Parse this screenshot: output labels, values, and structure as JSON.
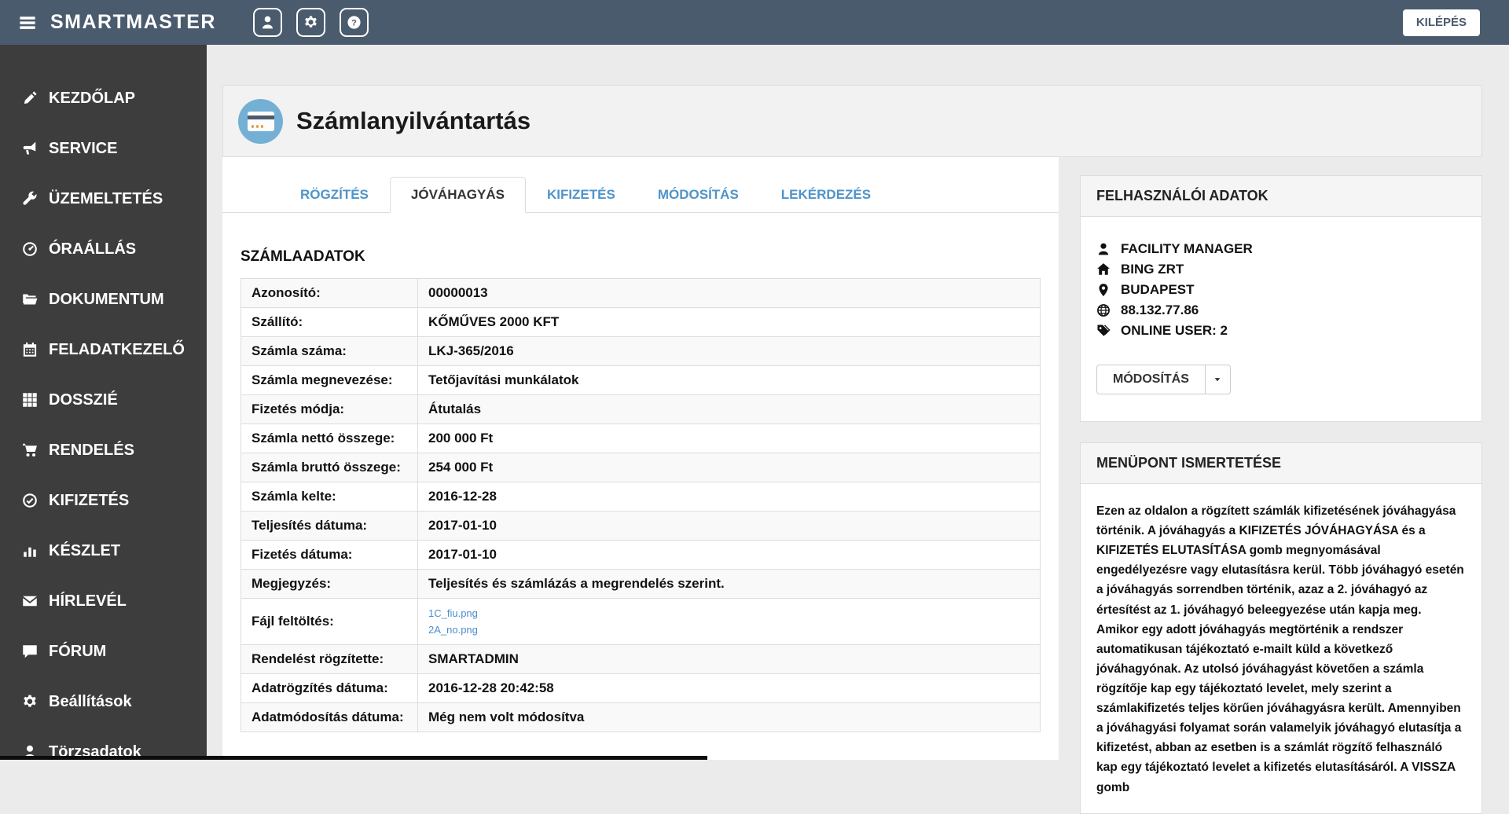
{
  "colors": {
    "topbar": "#4b5b6e",
    "sidebar": "#3d3d3d",
    "accent": "#4f94c9",
    "link": "#4b8fce",
    "icon_circle": "#74b0d4"
  },
  "header": {
    "app_title": "SMARTMASTER",
    "logout_label": "KILÉPÉS"
  },
  "sidebar": {
    "items": [
      {
        "name": "kezdolap",
        "icon": "edit",
        "label": "KEZDŐLAP"
      },
      {
        "name": "service",
        "icon": "megaphone",
        "label": "SERVICE"
      },
      {
        "name": "uzemeltetes",
        "icon": "wrench",
        "label": "ÜZEMELTETÉS"
      },
      {
        "name": "oraallas",
        "icon": "gauge",
        "label": "ÓRAÁLLÁS"
      },
      {
        "name": "dokumentum",
        "icon": "folder",
        "label": "DOKUMENTUM"
      },
      {
        "name": "feladatkezelo",
        "icon": "calendar",
        "label": "FELADATKEZELŐ"
      },
      {
        "name": "dosszie",
        "icon": "grid",
        "label": "DOSSZIÉ"
      },
      {
        "name": "rendeles",
        "icon": "cart",
        "label": "RENDELÉS"
      },
      {
        "name": "kifizetes",
        "icon": "check-circle",
        "label": "KIFIZETÉS"
      },
      {
        "name": "keszlet",
        "icon": "bar-chart",
        "label": "KÉSZLET"
      },
      {
        "name": "hirlevel",
        "icon": "envelope",
        "label": "HÍRLEVÉL"
      },
      {
        "name": "forum",
        "icon": "comment",
        "label": "FÓRUM"
      },
      {
        "name": "beallitasok",
        "icon": "gear",
        "label": "Beállítások"
      },
      {
        "name": "torzsadatok",
        "icon": "user",
        "label": "Törzsadatok"
      }
    ]
  },
  "page": {
    "title": "Számlanyilvántartás"
  },
  "tabs": [
    {
      "name": "rogzites",
      "label": "RÖGZÍTÉS",
      "active": false
    },
    {
      "name": "jovahagyas",
      "label": "JÓVÁHAGYÁS",
      "active": true
    },
    {
      "name": "kifizetes",
      "label": "KIFIZETÉS",
      "active": false
    },
    {
      "name": "modositas",
      "label": "MÓDOSÍTÁS",
      "active": false
    },
    {
      "name": "lekerdezes",
      "label": "LEKÉRDEZÉS",
      "active": false
    }
  ],
  "invoice": {
    "section_title": "SZÁMLAADATOK",
    "rows": [
      {
        "label": "Azonosító:",
        "value": "00000013"
      },
      {
        "label": "Szállító:",
        "value": "KŐMŰVES 2000 KFT"
      },
      {
        "label": "Számla száma:",
        "value": "LKJ-365/2016"
      },
      {
        "label": "Számla megnevezése:",
        "value": "Tetőjavítási munkálatok"
      },
      {
        "label": "Fizetés módja:",
        "value": "Átutalás"
      },
      {
        "label": "Számla nettó összege:",
        "value": "200 000 Ft"
      },
      {
        "label": "Számla bruttó összege:",
        "value": "254 000 Ft"
      },
      {
        "label": "Számla kelte:",
        "value": "2016-12-28"
      },
      {
        "label": "Teljesítés dátuma:",
        "value": "2017-01-10"
      },
      {
        "label": "Fizetés dátuma:",
        "value": "2017-01-10"
      },
      {
        "label": "Megjegyzés:",
        "value": "Teljesítés és számlázás a megrendelés szerint."
      },
      {
        "label": "Fájl feltöltés:",
        "links": [
          "1C_fiu.png",
          "2A_no.png"
        ]
      },
      {
        "label": "Rendelést rögzítette:",
        "value": "SMARTADMIN"
      },
      {
        "label": "Adatrögzítés dátuma:",
        "value": "2016-12-28 20:42:58"
      },
      {
        "label": "Adatmódosítás dátuma:",
        "value": "Még nem volt módosítva"
      }
    ]
  },
  "user_panel": {
    "title": "FELHASZNÁLÓI ADATOK",
    "entries": [
      {
        "icon": "user",
        "text": "FACILITY MANAGER"
      },
      {
        "icon": "home",
        "text": "BING ZRT"
      },
      {
        "icon": "map-marker",
        "text": "BUDAPEST"
      },
      {
        "icon": "globe",
        "text": "88.132.77.86"
      },
      {
        "icon": "tags",
        "text": "ONLINE USER: 2"
      }
    ],
    "modify_label": "MÓDOSÍTÁS"
  },
  "info_panel": {
    "title": "MENÜPONT ISMERTETÉSE",
    "text": "Ezen az oldalon a rögzített számlák kifizetésének jóváhagyása történik. A jóváhagyás a KIFIZETÉS JÓVÁHAGYÁSA és a KIFIZETÉS ELUTASÍTÁSA gomb megnyomásával engedélyezésre vagy elutasításra kerül. Több jóváhagyó esetén a jóváhagyás sorrendben történik, azaz a 2. jóváhagyó az értesítést az 1. jóváhagyó beleegyezése után kapja meg. Amikor egy adott jóváhagyás megtörténik a rendszer automatikusan tájékoztató e-mailt küld a következő jóváhagyónak. Az utolsó jóváhagyást követően a számla rögzítője kap egy tájékoztató levelet, mely szerint a számlakifizetés teljes körűen jóváhagyásra került. Amennyiben a jóváhagyási folyamat során valamelyik jóváhagyó elutasítja a kifizetést, abban az esetben is a számlát rögzítő felhasználó kap egy tájékoztató levelet a kifizetés elutasításáról. A VISSZA gomb"
  }
}
